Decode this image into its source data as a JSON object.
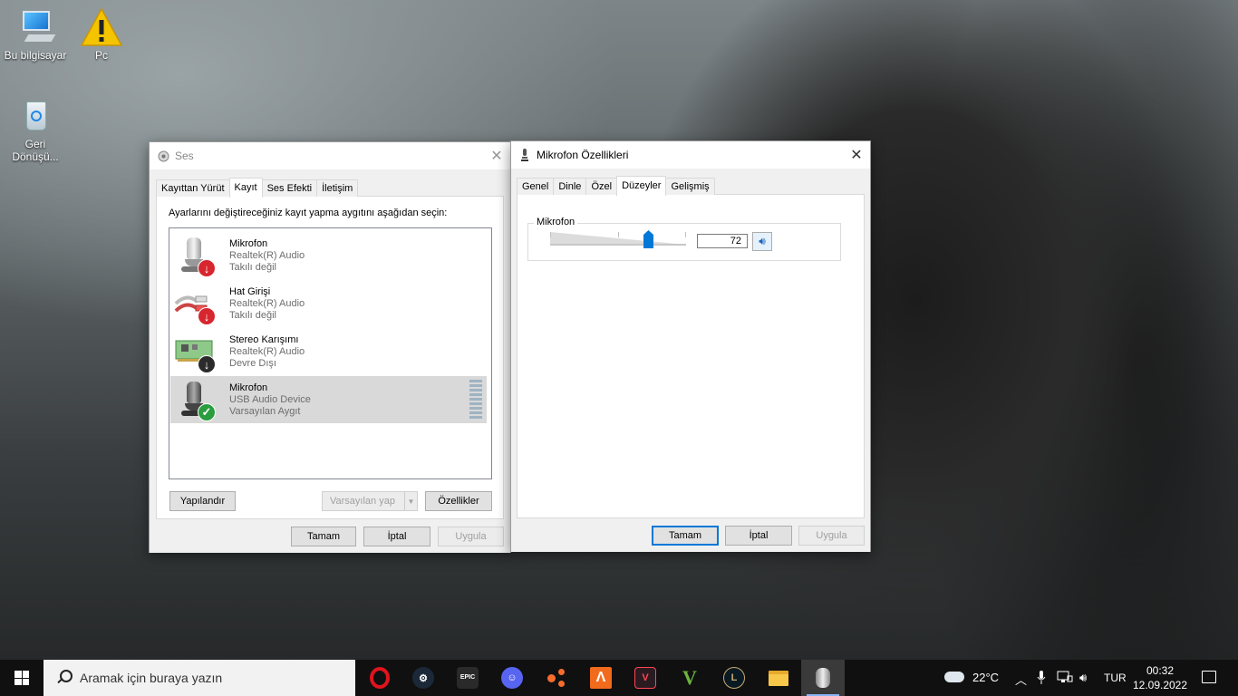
{
  "desktop": {
    "icons": [
      {
        "label": "Bu bilgisayar"
      },
      {
        "label": "Pc"
      },
      {
        "label": "Geri Dönüşü..."
      }
    ]
  },
  "sound_window": {
    "title": "Ses",
    "tabs": [
      "Kayıttan Yürüt",
      "Kayıt",
      "Ses Efekti",
      "İletişim"
    ],
    "active_tab": "Kayıt",
    "instruction": "Ayarlarını değiştireceğiniz kayıt yapma aygıtını aşağıdan seçin:",
    "devices": [
      {
        "name": "Mikrofon",
        "driver": "Realtek(R) Audio",
        "status": "Takılı değil",
        "icon": "microphone-icon",
        "badge": "unplugged-red-arrow"
      },
      {
        "name": "Hat Girişi",
        "driver": "Realtek(R) Audio",
        "status": "Takılı değil",
        "icon": "line-in-cable-icon",
        "badge": "unplugged-red-arrow"
      },
      {
        "name": "Stereo Karışımı",
        "driver": "Realtek(R) Audio",
        "status": "Devre Dışı",
        "icon": "sound-card-icon",
        "badge": "disabled-black-arrow"
      },
      {
        "name": "Mikrofon",
        "driver": "USB Audio Device",
        "status": "Varsayılan Aygıt",
        "icon": "microphone-icon",
        "badge": "default-green-check",
        "selected": true
      }
    ],
    "buttons": {
      "configure": "Yapılandır",
      "set_default": "Varsayılan yap",
      "properties": "Özellikler",
      "ok": "Tamam",
      "cancel": "İptal",
      "apply": "Uygula"
    }
  },
  "mic_props_window": {
    "title": "Mikrofon Özellikleri",
    "tabs": [
      "Genel",
      "Dinle",
      "Özel",
      "Düzeyler",
      "Gelişmiş"
    ],
    "active_tab": "Düzeyler",
    "levels": {
      "group_label": "Mikrofon",
      "value": "72",
      "value_fraction": 0.72
    },
    "buttons": {
      "ok": "Tamam",
      "cancel": "İptal",
      "apply": "Uygula"
    }
  },
  "taskbar": {
    "search_placeholder": "Aramak için buraya yazın",
    "apps": [
      "Opera",
      "Steam",
      "Epic Games",
      "Discord",
      "Origin",
      "Arc",
      "Valorant",
      "GTA V",
      "League of Legends",
      "File Explorer",
      "Ses"
    ],
    "weather": "22°C",
    "language": "TUR",
    "time": "00:32",
    "date": "12.09.2022"
  },
  "colors": {
    "accent": "#0078d7",
    "badge_red": "#d7262e",
    "badge_green": "#2a9d3f"
  }
}
